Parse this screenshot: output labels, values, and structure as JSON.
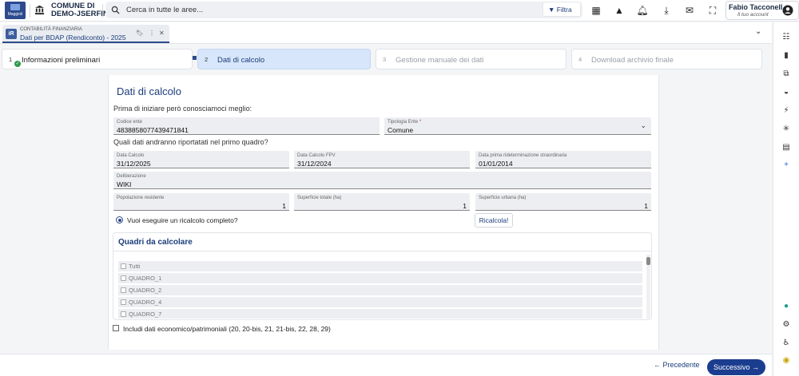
{
  "header": {
    "logo_text": "Maggioli",
    "org_name_line1": "COMUNE DI",
    "org_name_line2": "DEMO-JSERFIN",
    "search_placeholder": "Cerca in tutte le aree...",
    "filter_label": "Filtra",
    "user_name": "Fabio Tacconell...",
    "user_account": "Il tuo account"
  },
  "doc_tab": {
    "badge": "iR",
    "category": "CONTABILITÀ FINANZIARIA",
    "title": "Dati per BDAP (Rendiconto) - 2025"
  },
  "steps": [
    {
      "num": "1",
      "label": "Informazioni preliminari",
      "state": "done"
    },
    {
      "num": "2",
      "label": "Dati di calcolo",
      "state": "active"
    },
    {
      "num": "3",
      "label": "Gestione manuale dei dati",
      "state": "disabled"
    },
    {
      "num": "4",
      "label": "Download archivio finale",
      "state": "disabled"
    }
  ],
  "form": {
    "title": "Dati di calcolo",
    "intro": "Prima di iniziare però conosciamoci meglio:",
    "codice_ente": {
      "label": "Codice ente",
      "value": "4838858077439471841"
    },
    "tipologia_ente": {
      "label": "Tipologia Ente",
      "required_mark": "*",
      "value": "Comune"
    },
    "question2": "Quali dati andranno riportatati nel primo quadro?",
    "data_calcolo": {
      "label": "Data Calcolo",
      "value": "31/12/2025"
    },
    "data_calcolo_fpv": {
      "label": "Data Calcolo FPV",
      "value": "31/12/2024"
    },
    "data_rideterminazione": {
      "label": "Data prima rideterminazione straordinaria",
      "value": "01/01/2014"
    },
    "deliberazione": {
      "label": "Deliberazione",
      "value": "WIKI"
    },
    "popolazione": {
      "label": "Popolazione residente",
      "value": "1"
    },
    "superficie_totale": {
      "label": "Superficie totale (ha)",
      "value": "1"
    },
    "superficie_urbana": {
      "label": "Superficie urbana (ha)",
      "value": "1"
    },
    "ricalcolo_question": "Vuoi eseguire un ricalcolo completo?",
    "ricalcola_button": "Ricalcola!",
    "quadri_title": "Quadri da calcolare",
    "quadri": [
      "Tutti",
      "QUADRO_1",
      "QUADRO_2",
      "QUADRO_4",
      "QUADRO_7"
    ],
    "economico_label": "Includi dati economico/patrimoniali (20, 20-bis, 21, 21-bis, 22, 28, 29)"
  },
  "footer": {
    "prev_label": "Precedente",
    "next_label": "Successivo"
  },
  "colors": {
    "primary": "#1b3d8f",
    "active_step": "#d7e6fa",
    "success": "#2e9a4b"
  }
}
